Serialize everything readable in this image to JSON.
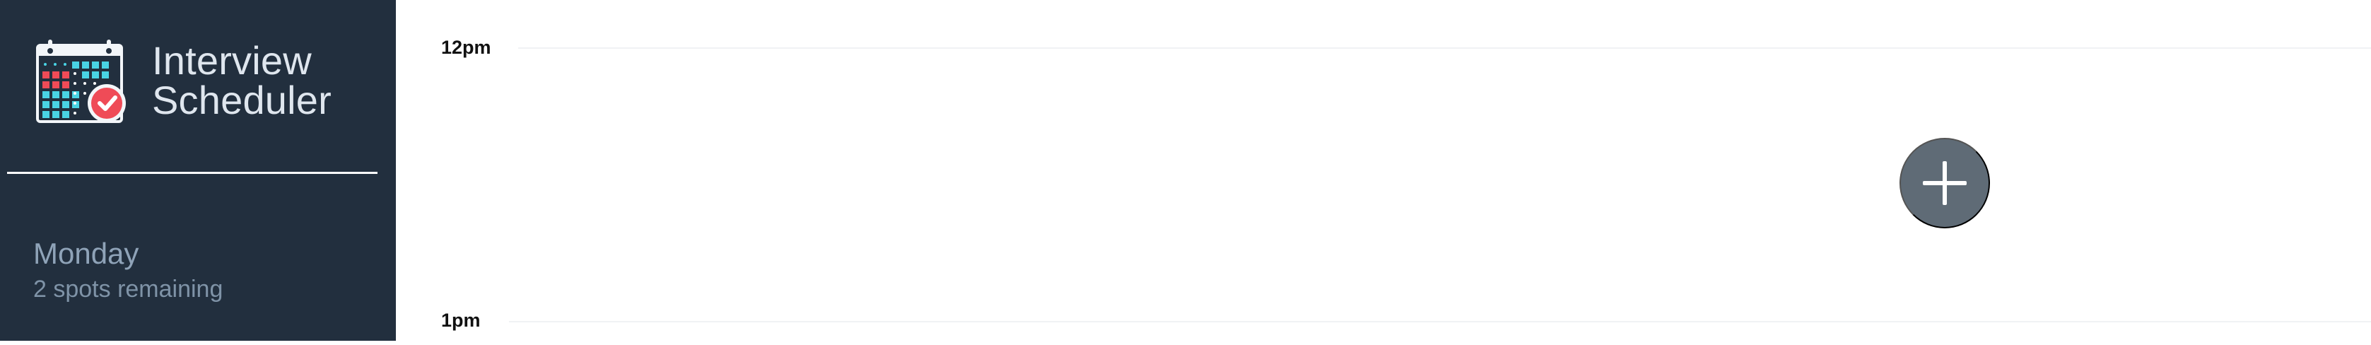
{
  "app": {
    "title_line_1": "Interview",
    "title_line_2": "Scheduler",
    "logo_icon": "calendar-check-icon"
  },
  "sidebar": {
    "day": {
      "name": "Monday",
      "spots": "2 spots remaining"
    }
  },
  "schedule": {
    "times": [
      {
        "label": "12pm"
      },
      {
        "label": "1pm"
      }
    ],
    "add_button": {
      "icon": "plus-icon"
    }
  },
  "colors": {
    "sidebar_background": "#222f3e",
    "add_button": "#5f6b76",
    "calendar_red": "#ef4b57",
    "calendar_cyan": "#49d3e4",
    "day_text": "#8fa3b8"
  }
}
